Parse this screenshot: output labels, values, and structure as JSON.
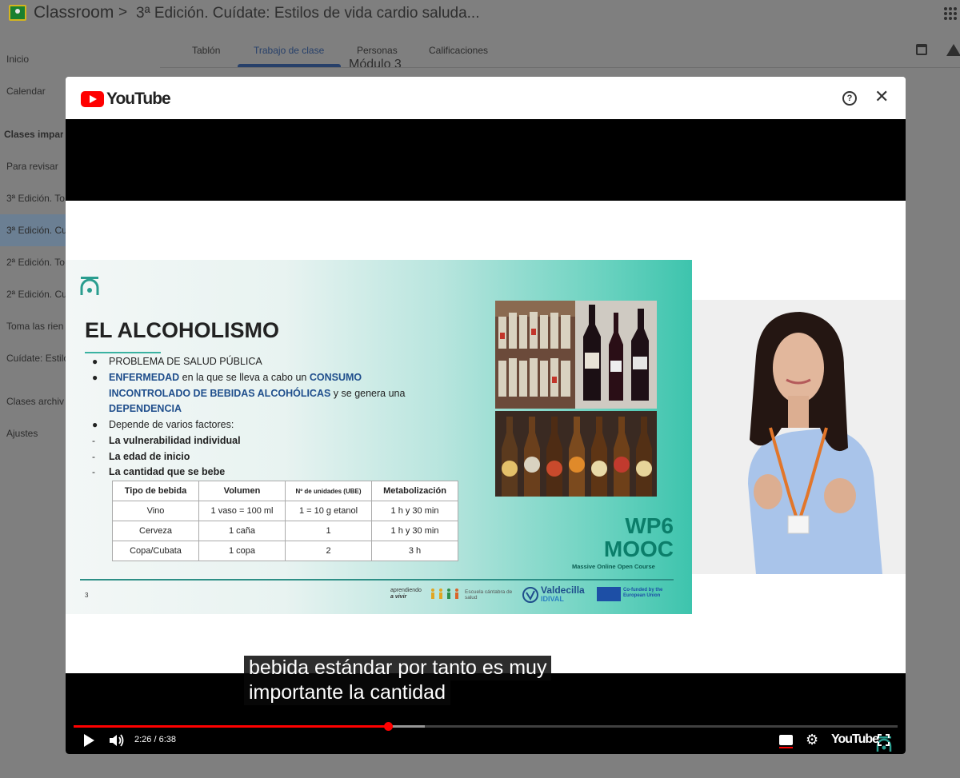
{
  "topbar": {
    "app_name": "Classroom",
    "separator": ">",
    "course_title": "3ª Edición. Cuídate: Estilos de vida cardio saluda..."
  },
  "sidebar": {
    "items": [
      {
        "label": "Inicio"
      },
      {
        "label": "Calendar"
      },
      {
        "label": "Clases impart"
      },
      {
        "label": "Para revisar"
      },
      {
        "label": "3ª Edición. To"
      },
      {
        "label": "3ª Edición. Cu"
      },
      {
        "label": "2ª Edición. To"
      },
      {
        "label": "2ª Edición. Cu"
      },
      {
        "label": "Toma las rien"
      },
      {
        "label": "Cuídate: Estilo"
      },
      {
        "label": "Clases archiv"
      },
      {
        "label": "Ajustes"
      }
    ]
  },
  "tabs": [
    {
      "label": "Tablón"
    },
    {
      "label": "Trabajo de clase"
    },
    {
      "label": "Personas"
    },
    {
      "label": "Calificaciones"
    }
  ],
  "module_peek": "Módulo 3",
  "modal": {
    "brand": "YouTube",
    "help_glyph": "?",
    "close_glyph": "✕"
  },
  "slide": {
    "title": "EL ALCOHOLISMO",
    "bullet1": "PROBLEMA DE SALUD PÚBLICA",
    "bullet2_a": "ENFERMEDAD",
    "bullet2_b": " en la que se lleva a cabo un ",
    "bullet2_c": "CONSUMO",
    "bullet2_d": "INCONTROLADO DE BEBIDAS ALCOHÓLICAS",
    "bullet2_e": " y se genera una",
    "bullet2_f": "DEPENDENCIA",
    "bullet3": "Depende de varios factores:",
    "factor1": "La vulnerabilidad individual",
    "factor2": "La edad de inicio",
    "factor3": "La cantidad que se bebe",
    "table": {
      "headers": [
        "Tipo de bebida",
        "Volumen",
        "Nº de unidades (UBE)",
        "Metabolización"
      ],
      "rows": [
        [
          "Vino",
          "1 vaso = 100 ml",
          "1 = 10 g etanol",
          "1 h y  30 min"
        ],
        [
          "Cerveza",
          "1 caña",
          "1",
          "1 h y 30 min"
        ],
        [
          "Copa/Cubata",
          "1 copa",
          "2",
          "3 h"
        ]
      ]
    },
    "wp6_line1": "WP6",
    "wp6_line2": "MOOC",
    "wp6_sub": "Massive Online Open Course",
    "page_number": "3",
    "footer_logo1_a": "aprendiendo",
    "footer_logo1_b": "a vivir",
    "footer_logo1_c": "Escuela cántabra de salud",
    "footer_logo2_a": "Valdecilla",
    "footer_logo2_b": "IDIVAL",
    "footer_logo3": "Co-funded by the European Union"
  },
  "captions": {
    "line1": "bebida estándar por tanto es muy",
    "line2": "importante la cantidad"
  },
  "player": {
    "time": "2:26 / 6:38",
    "progress_fraction": 0.382,
    "buffered_fraction": 0.426,
    "brand": "YouTube",
    "gear_glyph": "⚙"
  }
}
